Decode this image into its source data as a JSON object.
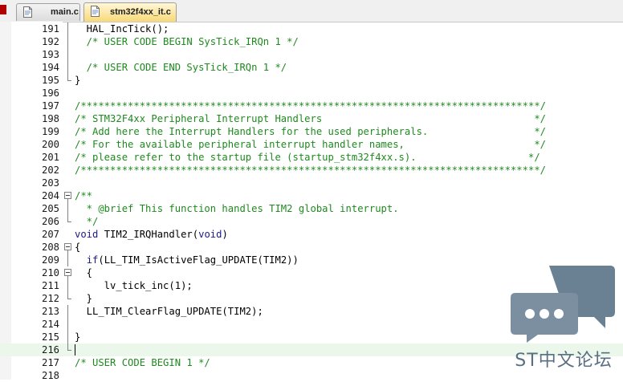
{
  "tabs": [
    {
      "label": "main.c",
      "active": false
    },
    {
      "label": "stm32f4xx_it.c",
      "active": true
    }
  ],
  "lines": [
    {
      "num": "191",
      "fold": "line",
      "text": "  HAL_IncTick();",
      "kind": "code"
    },
    {
      "num": "192",
      "fold": "line",
      "text": "  /* USER CODE BEGIN SysTick_IRQn 1 */",
      "kind": "comment"
    },
    {
      "num": "193",
      "fold": "line",
      "text": "",
      "kind": "code"
    },
    {
      "num": "194",
      "fold": "line",
      "text": "  /* USER CODE END SysTick_IRQn 1 */",
      "kind": "comment"
    },
    {
      "num": "195",
      "fold": "end",
      "text": "}",
      "kind": "code"
    },
    {
      "num": "196",
      "fold": "none",
      "text": "",
      "kind": "code"
    },
    {
      "num": "197",
      "fold": "none",
      "text": "/******************************************************************************/",
      "kind": "comment"
    },
    {
      "num": "198",
      "fold": "none",
      "text": "/* STM32F4xx Peripheral Interrupt Handlers                                    */",
      "kind": "comment"
    },
    {
      "num": "199",
      "fold": "none",
      "text": "/* Add here the Interrupt Handlers for the used peripherals.                  */",
      "kind": "comment"
    },
    {
      "num": "200",
      "fold": "none",
      "text": "/* For the available peripheral interrupt handler names,                      */",
      "kind": "comment"
    },
    {
      "num": "201",
      "fold": "none",
      "text": "/* please refer to the startup file (startup_stm32f4xx.s).                   */",
      "kind": "comment"
    },
    {
      "num": "202",
      "fold": "none",
      "text": "/******************************************************************************/",
      "kind": "comment"
    },
    {
      "num": "203",
      "fold": "none",
      "text": "",
      "kind": "code"
    },
    {
      "num": "204",
      "fold": "box",
      "text": "/**",
      "kind": "comment"
    },
    {
      "num": "205",
      "fold": "line",
      "text": "  * @brief This function handles TIM2 global interrupt.",
      "kind": "comment"
    },
    {
      "num": "206",
      "fold": "end",
      "text": "  */",
      "kind": "comment"
    },
    {
      "num": "207",
      "fold": "none",
      "text": "void TIM2_IRQHandler(void)",
      "kind": "func"
    },
    {
      "num": "208",
      "fold": "box",
      "text": "{",
      "kind": "code"
    },
    {
      "num": "209",
      "fold": "line",
      "text": "  if(LL_TIM_IsActiveFlag_UPDATE(TIM2))",
      "kind": "code"
    },
    {
      "num": "210",
      "fold": "box",
      "text": "  {",
      "kind": "code"
    },
    {
      "num": "211",
      "fold": "line",
      "text": "     lv_tick_inc(1);",
      "kind": "code"
    },
    {
      "num": "212",
      "fold": "end",
      "text": "  }",
      "kind": "code"
    },
    {
      "num": "213",
      "fold": "line",
      "text": "  LL_TIM_ClearFlag_UPDATE(TIM2);",
      "kind": "code"
    },
    {
      "num": "214",
      "fold": "line",
      "text": "",
      "kind": "code"
    },
    {
      "num": "215",
      "fold": "line",
      "text": "}",
      "kind": "code"
    },
    {
      "num": "216",
      "fold": "end",
      "text": "",
      "kind": "code",
      "current": true
    },
    {
      "num": "217",
      "fold": "none",
      "text": "/* USER CODE BEGIN 1 */",
      "kind": "comment"
    },
    {
      "num": "218",
      "fold": "none",
      "text": "",
      "kind": "code"
    }
  ],
  "watermark": {
    "text": "ST中文论坛",
    "icon": "chat-bubbles-icon"
  },
  "colors": {
    "comment": "#1e8a1e",
    "keyword": "#1a1a8a",
    "current_line": "#eaf7ea",
    "active_tab": "#f8d978"
  }
}
